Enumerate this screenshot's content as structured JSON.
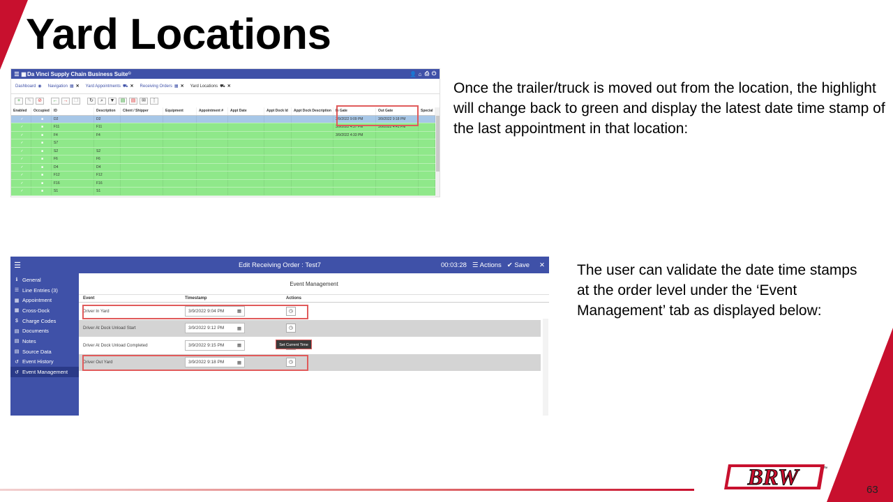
{
  "slide": {
    "title": "Yard Locations",
    "page_number": "63",
    "paragraph1": "Once the trailer/truck is moved out from the location, the highlight will change back to green and display the latest date time stamp of the last appointment in that location:",
    "paragraph2": "The user can validate the date time stamps at the order level under the ‘Event Management’ tab as displayed below:",
    "logo_text": "BRW",
    "logo_mark": "™",
    "accent_color": "#c8102e"
  },
  "screenshot1": {
    "app_title": "Da Vinci Supply Chain Business Suite",
    "app_title_mark": "©",
    "tabs": [
      {
        "label": "Dashboard",
        "icon": "dashboard-icon",
        "closable": false
      },
      {
        "label": "Navigation",
        "icon": "grid-icon",
        "closable": true
      },
      {
        "label": "Yard Appointments",
        "icon": "truck-icon",
        "closable": true
      },
      {
        "label": "Receiving Orders",
        "icon": "calendar-icon",
        "closable": true
      },
      {
        "label": "Yard Locations",
        "icon": "truck-icon",
        "closable": true
      }
    ],
    "columns": [
      "Enabled",
      "Occupied",
      "ID",
      "Description",
      "Client / Shipper",
      "Equipment",
      "Appointment #",
      "Appt Date",
      "Appt Dock Id",
      "Appt Dock Description",
      "In Gate",
      "Out Gate",
      "Special"
    ],
    "rows": [
      {
        "id": "D2",
        "description": "D2",
        "in_gate": "3/9/2022 9:09 PM",
        "out_gate": "3/9/2022 9:18 PM",
        "selected": true
      },
      {
        "id": "F11",
        "description": "F11",
        "in_gate": "3/9/2022 4:37 PM",
        "out_gate": "3/9/2022 4:41 PM",
        "selected": false
      },
      {
        "id": "F4",
        "description": "F4",
        "in_gate": "3/9/2022 4:33 PM",
        "out_gate": "",
        "selected": false
      },
      {
        "id": "S7",
        "description": "",
        "in_gate": "",
        "out_gate": "",
        "selected": false
      },
      {
        "id": "S2",
        "description": "S2",
        "in_gate": "",
        "out_gate": "",
        "selected": false
      },
      {
        "id": "F6",
        "description": "F6",
        "in_gate": "",
        "out_gate": "",
        "selected": false
      },
      {
        "id": "D4",
        "description": "D4",
        "in_gate": "",
        "out_gate": "",
        "selected": false
      },
      {
        "id": "F12",
        "description": "F12",
        "in_gate": "",
        "out_gate": "",
        "selected": false
      },
      {
        "id": "F16",
        "description": "F16",
        "in_gate": "",
        "out_gate": "",
        "selected": false
      },
      {
        "id": "S1",
        "description": "S1",
        "in_gate": "",
        "out_gate": "",
        "selected": false
      }
    ],
    "row_color": "#8fe88a",
    "selected_row_color": "#a7c7e7"
  },
  "screenshot2": {
    "title": "Edit Receiving Order : Test7",
    "timer": "00:03:28",
    "actions_label": "Actions",
    "save_label": "Save",
    "nav": [
      {
        "label": "General",
        "icon": "info-icon"
      },
      {
        "label": "Line Entries (3)",
        "icon": "list-icon"
      },
      {
        "label": "Appointment",
        "icon": "calendar-icon"
      },
      {
        "label": "Cross-Dock",
        "icon": "calendar-icon"
      },
      {
        "label": "Charge Codes",
        "icon": "dollar-icon"
      },
      {
        "label": "Documents",
        "icon": "document-icon"
      },
      {
        "label": "Notes",
        "icon": "document-icon"
      },
      {
        "label": "Source Data",
        "icon": "document-icon"
      },
      {
        "label": "Event History",
        "icon": "history-icon"
      },
      {
        "label": "Event Management",
        "icon": "history-icon",
        "active": true
      }
    ],
    "section_title": "Event Management",
    "columns": {
      "event": "Event",
      "timestamp": "Timestamp",
      "actions": "Actions"
    },
    "events": [
      {
        "event": "Driver In Yard",
        "timestamp": "3/9/2022 9:04 PM"
      },
      {
        "event": "Driver At Dock Unload Start",
        "timestamp": "3/9/2022 9:12 PM"
      },
      {
        "event": "Driver At Dock Unload Completed",
        "timestamp": "3/9/2022 9:15 PM"
      },
      {
        "event": "Driver Out Yard",
        "timestamp": "3/9/2022 9:18 PM"
      }
    ],
    "tooltip": "Set Current Time",
    "sidebar_color": "#3f51a8"
  }
}
